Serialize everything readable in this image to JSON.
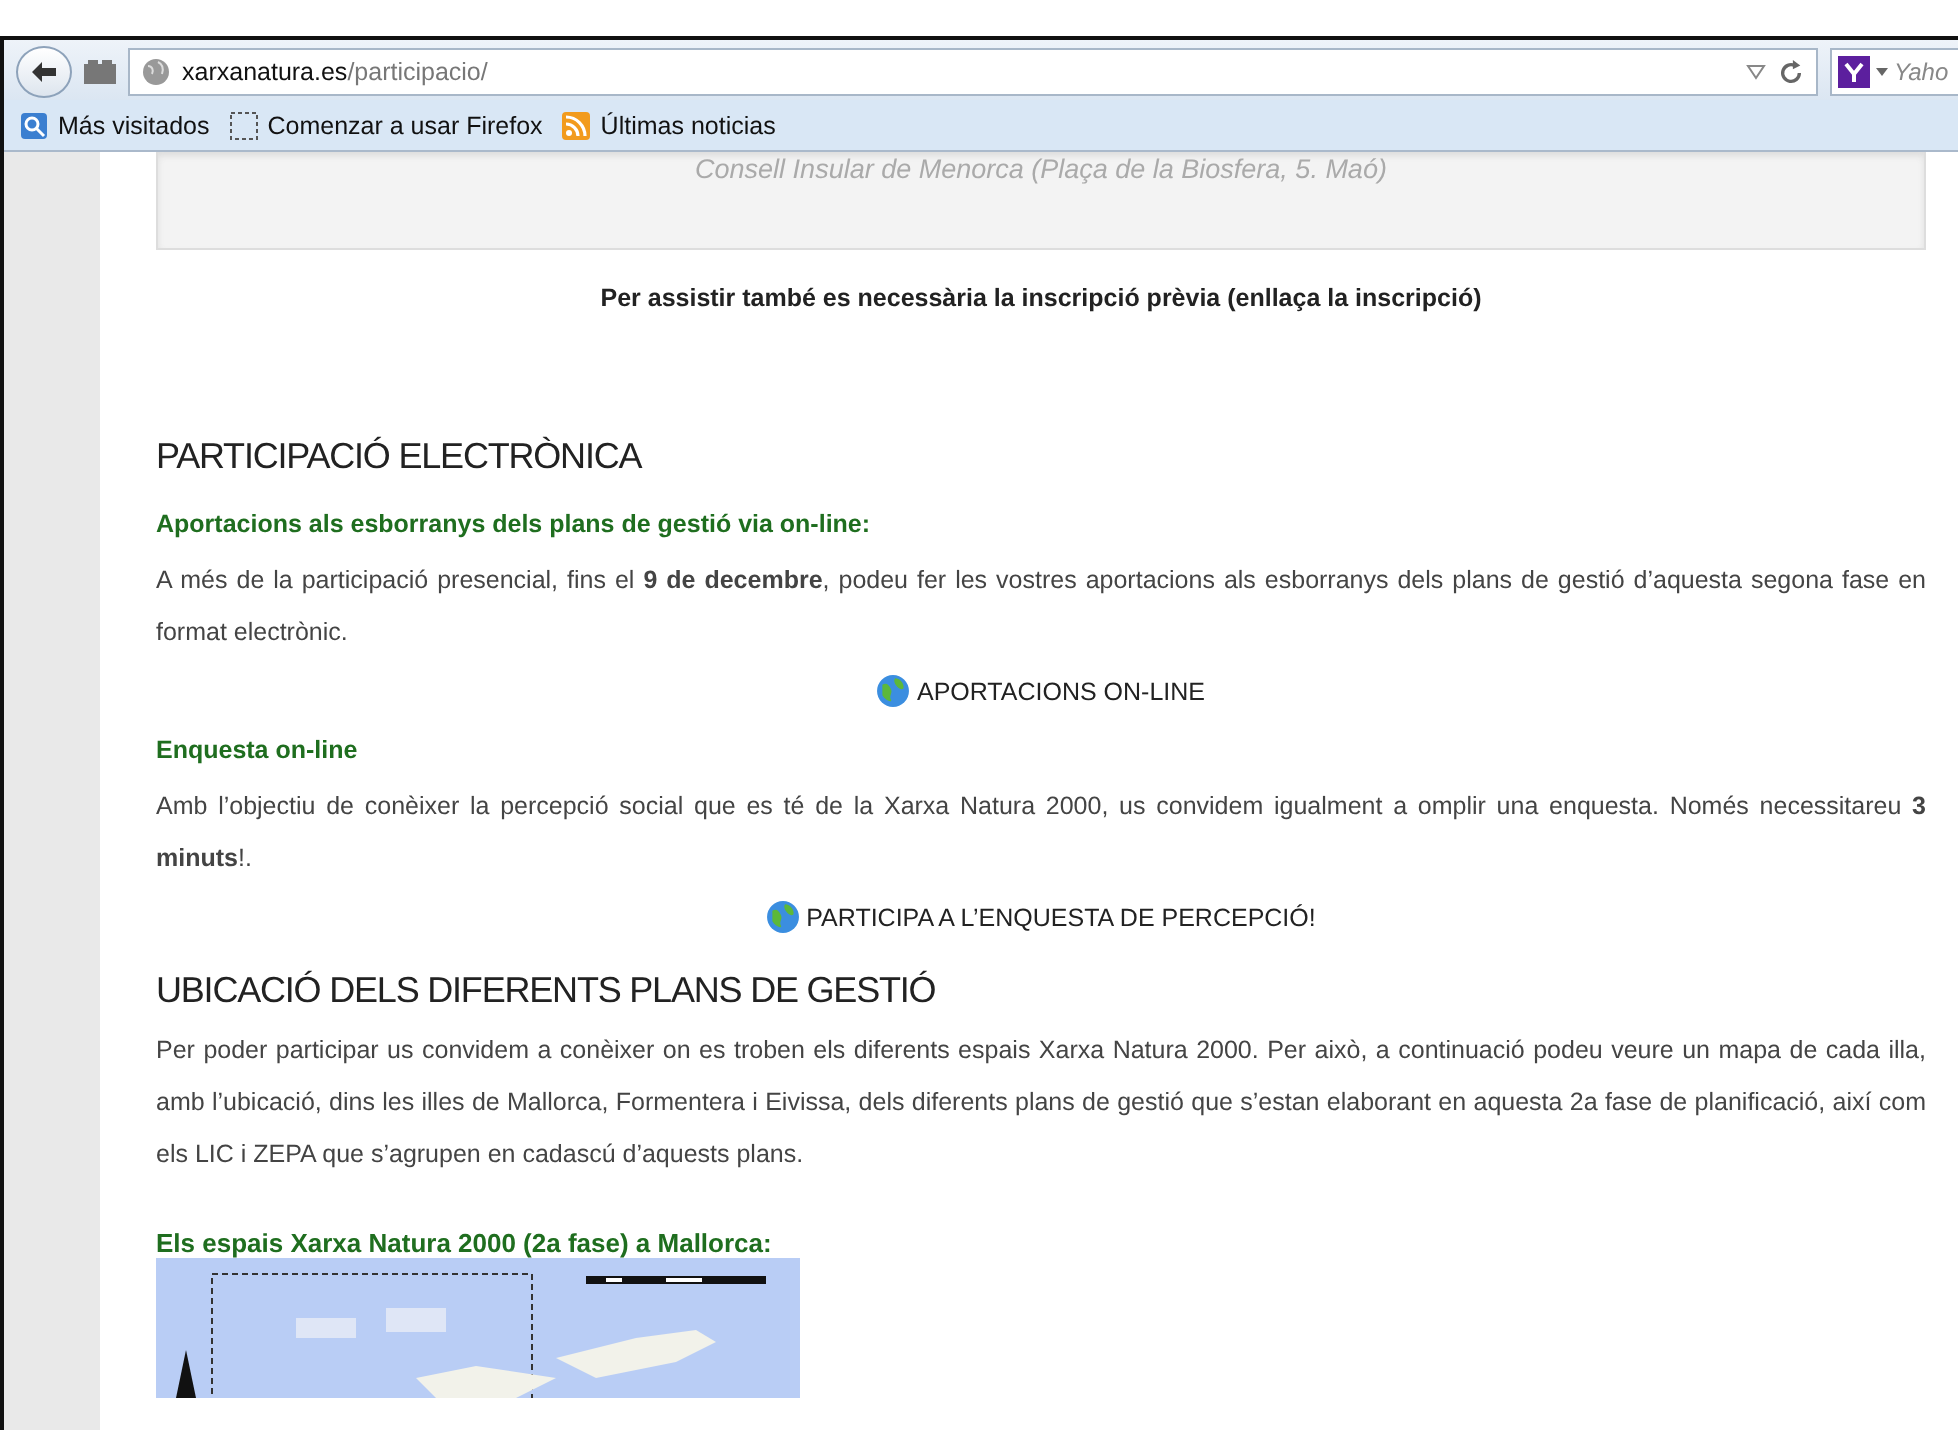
{
  "browser": {
    "url_host": "xarxanatura.es",
    "url_path": "/participacio/",
    "search_placeholder": "Yaho"
  },
  "bookmarks": [
    {
      "label": "Más visitados",
      "kind": "search"
    },
    {
      "label": "Comenzar a usar Firefox",
      "kind": "blank"
    },
    {
      "label": "Últimas noticias",
      "kind": "feed"
    }
  ],
  "notice_box": {
    "text": "Consell Insular de Menorca (Plaça de la Biosfera, 5. Maó)"
  },
  "blocks": [
    {
      "kind": "note",
      "text": "Per assistir també es necessària la inscripció prèvia (enllaça la inscripció)"
    },
    {
      "kind": "heading",
      "text": "PARTICIPACIÓ ELECTRÒNICA"
    },
    {
      "kind": "subheading",
      "text": "Aportacions als esborranys dels plans de gestió via on-line:"
    },
    {
      "kind": "paragraph",
      "text": "A més de la participació presencial, fins el **9 de decembre**, podeu fer les vostres aportacions als esborranys dels plans de gestió d’aquesta segona fase en format electrònic."
    },
    {
      "kind": "link",
      "text": "APORTACIONS ON-LINE"
    },
    {
      "kind": "subheading",
      "text": "Enquesta on-line"
    },
    {
      "kind": "paragraph",
      "text": "Amb l’objectiu de conèixer la percepció social que es té de la Xarxa Natura 2000, us convidem igualment a omplir una enquesta. Només necessitareu **3 minuts**!."
    },
    {
      "kind": "link",
      "text": "PARTICIPA A L’ENQUESTA DE PERCEPCIÓ!"
    },
    {
      "kind": "heading",
      "text": "UBICACIÓ DELS DIFERENTS PLANS DE GESTIÓ"
    },
    {
      "kind": "paragraph",
      "text": "Per poder participar us convidem a conèixer on es troben els diferents espais Xarxa Natura 2000. Per això, a continuació podeu veure un mapa de cada illa, amb l’ubicació, dins les illes de Mallorca, Formentera i Eivissa, dels diferents plans de gestió que s’estan elaborant en aquesta 2a fase de planificació, així com els LIC i ZEPA que s’agrupen en cadascú d’aquests plans."
    },
    {
      "kind": "map_title",
      "text": "Els espais Xarxa Natura 2000 (2a fase) a Mallorca:"
    },
    {
      "kind": "picture"
    }
  ]
}
